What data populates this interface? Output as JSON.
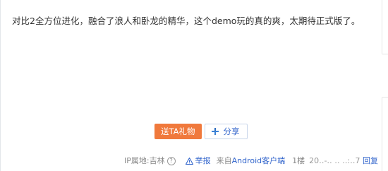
{
  "post": {
    "text": "对比2全方位进化，融合了浪人和卧龙的精华，这个demo玩的真的爽，太期待正式版了。"
  },
  "actions": {
    "gift_label": "送TA礼物",
    "share_label": "分享"
  },
  "footer": {
    "ip_label": "IP属地:吉林",
    "report_label": "举报",
    "from_prefix": "来自",
    "client_label": "Android客户端",
    "floor_label": "1楼",
    "time_text": "20‥-‥ ‥ ‥:‥7",
    "reply_label": "回复"
  },
  "colors": {
    "gift_button": "#f0793c",
    "link": "#3366cc",
    "text": "#333333",
    "muted": "#888888"
  },
  "icons": {
    "help": "help-circle-icon",
    "warning": "warning-icon",
    "share": "share-plus-icon"
  }
}
